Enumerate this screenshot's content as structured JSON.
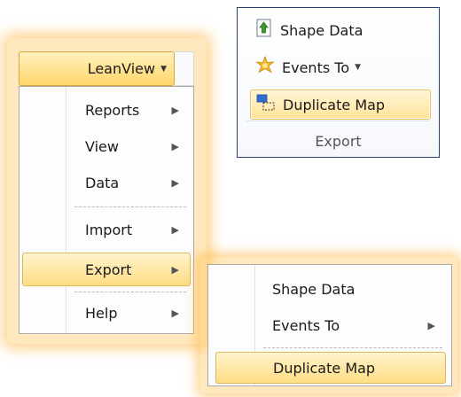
{
  "ribbon": {
    "buttons": [
      {
        "label": "Shape Data",
        "icon": "shape-data-icon"
      },
      {
        "label": "Events To",
        "icon": "events-icon",
        "has_dropdown": true
      },
      {
        "label": "Duplicate Map",
        "icon": "duplicate-map-icon"
      }
    ],
    "dropdown_glyph": "▼",
    "group_label": "Export"
  },
  "lean_menu": {
    "button_label": "LeanView",
    "dropdown_glyph": "▼",
    "submenu_glyph": "▶",
    "items": [
      {
        "label": "Reports"
      },
      {
        "label": "View"
      },
      {
        "label": "Data"
      },
      {
        "label": "Import"
      },
      {
        "label": "Export"
      },
      {
        "label": "Help"
      }
    ]
  },
  "export_submenu": {
    "items": [
      {
        "label": "Shape Data"
      },
      {
        "label": "Events To"
      },
      {
        "label": "Duplicate Map"
      }
    ]
  },
  "colors": {
    "highlight_gradient_top": "#fff4cf",
    "highlight_gradient_bottom": "#ffdd82",
    "glow": "#ffb43c",
    "ribbon_border": "#27446e"
  }
}
